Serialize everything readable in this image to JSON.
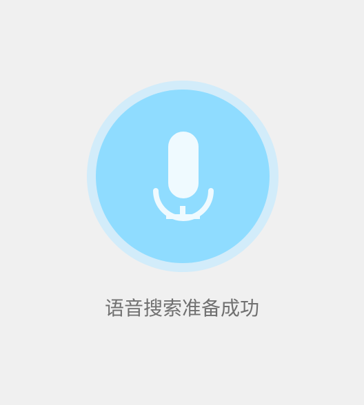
{
  "status": {
    "message": "语音搜索准备成功"
  },
  "mic": {
    "icon": "microphone-icon",
    "ring_color": "#d2ecfa",
    "button_color": "#8fdcff",
    "icon_color": "#effaff"
  },
  "colors": {
    "background": "#f0f0f0",
    "text": "#707070"
  }
}
